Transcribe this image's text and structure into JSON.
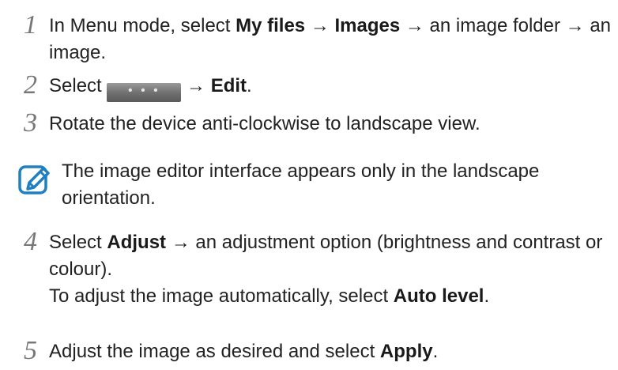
{
  "steps": [
    {
      "number": "1",
      "segments": [
        {
          "text": "In Menu mode, select ",
          "bold": false
        },
        {
          "text": "My files",
          "bold": true
        },
        {
          "text": " → ",
          "bold": false
        },
        {
          "text": "Images",
          "bold": true
        },
        {
          "text": " → an image folder → an image.",
          "bold": false
        }
      ]
    },
    {
      "number": "2",
      "pre": "Select",
      "button_glyph": "• • •",
      "arrow": "→",
      "edit": "Edit",
      "period": "."
    },
    {
      "number": "3",
      "text": "Rotate the device anti-clockwise to landscape view."
    },
    {
      "number": "4",
      "segments": [
        {
          "text": "Select ",
          "bold": false
        },
        {
          "text": "Adjust",
          "bold": true
        },
        {
          "text": " → an adjustment option (brightness and contrast or colour).",
          "bold": false
        }
      ],
      "subline_segments": [
        {
          "text": "To adjust the image automatically, select ",
          "bold": false
        },
        {
          "text": "Auto level",
          "bold": true
        },
        {
          "text": ".",
          "bold": false
        }
      ]
    },
    {
      "number": "5",
      "segments": [
        {
          "text": "Adjust the image as desired and select ",
          "bold": false
        },
        {
          "text": "Apply",
          "bold": true
        },
        {
          "text": ".",
          "bold": false
        }
      ]
    }
  ],
  "note": {
    "icon": "note-pencil-icon",
    "text": "The image editor interface appears only in the landscape orientation."
  },
  "colors": {
    "note_icon": "#1f7fc0",
    "step_number": "#777777"
  }
}
